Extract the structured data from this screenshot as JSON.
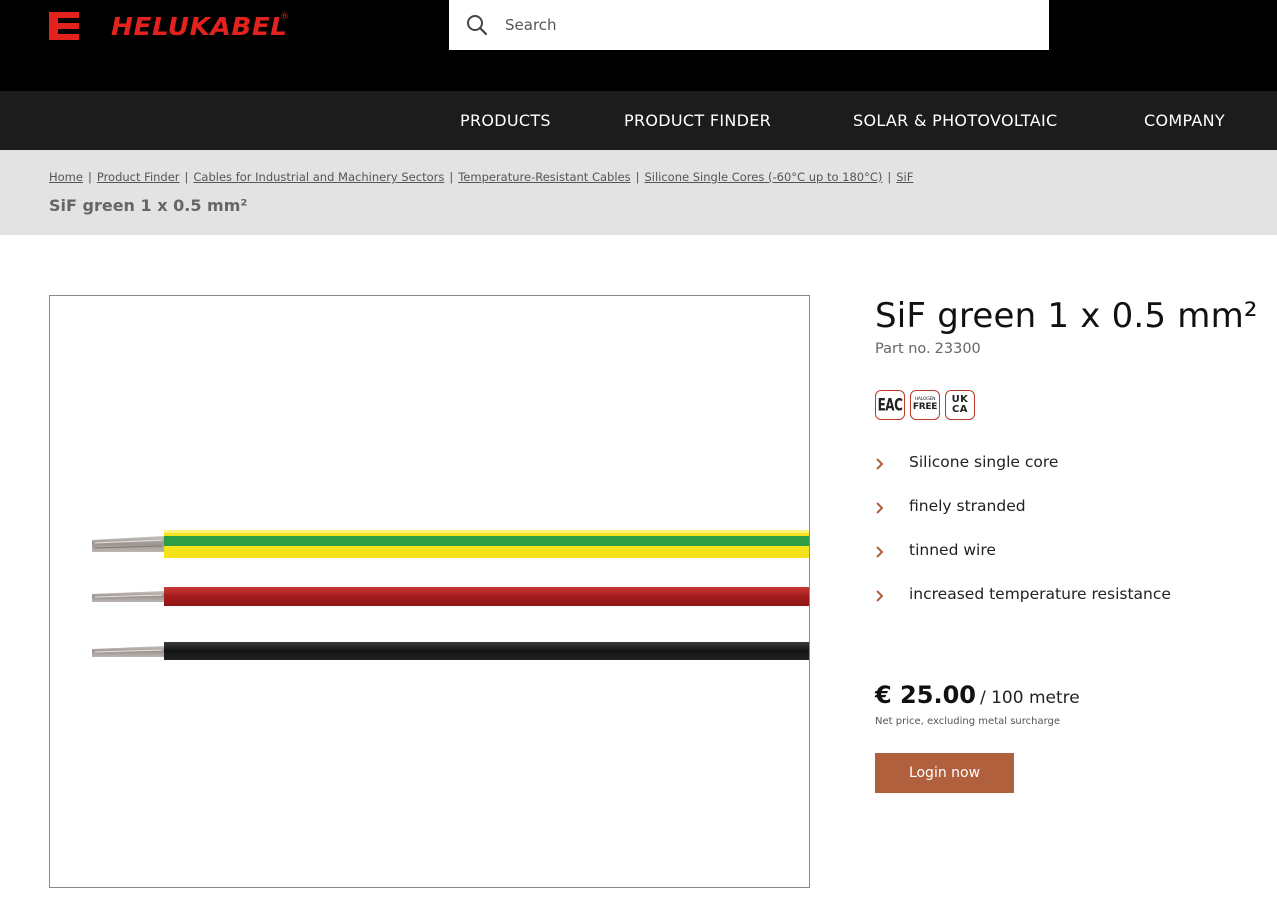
{
  "header": {
    "brand_name": "HELUKABEL",
    "brand_registered": "®",
    "brand_color": "#e3221e",
    "search_placeholder": "Search",
    "search_icon": "search-icon"
  },
  "nav": {
    "items": [
      {
        "label": "PRODUCTS"
      },
      {
        "label": "PRODUCT FINDER"
      },
      {
        "label": "SOLAR & PHOTOVOLTAIC"
      },
      {
        "label": "COMPANY"
      }
    ]
  },
  "breadcrumb": {
    "items": [
      {
        "label": "Home"
      },
      {
        "label": "Product Finder"
      },
      {
        "label": "Cables for Industrial and Machinery Sectors"
      },
      {
        "label": "Temperature-Resistant Cables"
      },
      {
        "label": "Silicone Single Cores (-60°C up to 180°C)"
      },
      {
        "label": "SiF"
      }
    ],
    "separator": "|",
    "current": "SiF green 1 x 0.5 mm²"
  },
  "product": {
    "title": "SiF green 1 x 0.5 mm²",
    "part_label": "Part no.",
    "part_number": "23300",
    "certifications": [
      {
        "name": "eac-icon",
        "text": "EAC"
      },
      {
        "name": "halogen-free-icon",
        "top": "HALOGEN",
        "bottom": "FREE"
      },
      {
        "name": "ukca-icon",
        "top": "UK",
        "bottom": "CA"
      }
    ],
    "features": [
      "Silicone single core",
      "finely stranded",
      "tinned wire",
      "increased temperature resistance"
    ],
    "image_wires": [
      {
        "name": "green-yellow-wire",
        "colors": [
          "#f5e21b",
          "#2e9d46"
        ]
      },
      {
        "name": "red-wire",
        "colors": [
          "#b32222"
        ]
      },
      {
        "name": "black-wire",
        "colors": [
          "#1e1e1e"
        ]
      }
    ],
    "price": {
      "amount": "€ 25.00",
      "unit": "/ 100 metre",
      "note": "Net price, excluding metal surcharge"
    },
    "login_label": "Login now",
    "accent_color": "#b0603d"
  }
}
